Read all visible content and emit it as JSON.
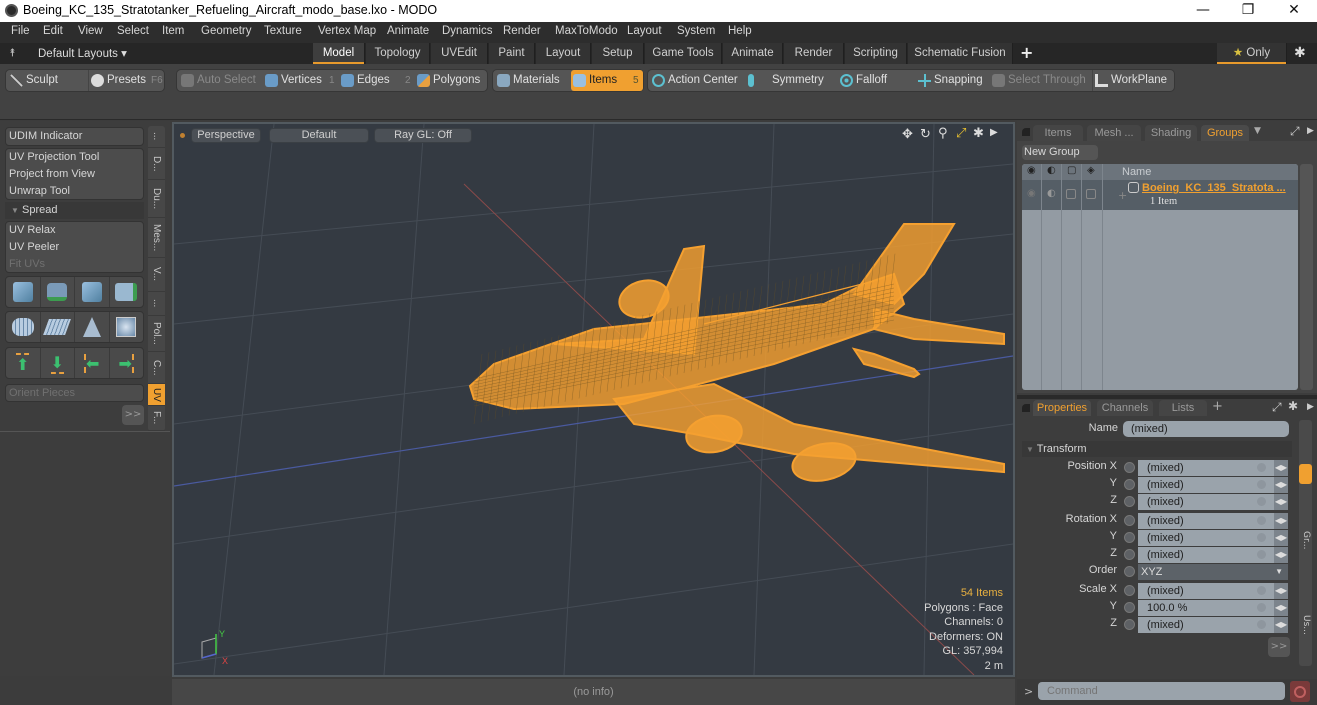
{
  "window": {
    "title": "Boeing_KC_135_Stratotanker_Refueling_Aircraft_modo_base.lxo - MODO",
    "minimize": "—",
    "restore": "❐",
    "close": "✕"
  },
  "menu": [
    "File",
    "Edit",
    "View",
    "Select",
    "Item",
    "Geometry",
    "Texture",
    "Vertex Map",
    "Animate",
    "Dynamics",
    "Render",
    "MaxToModo",
    "Layout",
    "System",
    "Help"
  ],
  "layoutbar": {
    "layouts_label": "Default Layouts ▾",
    "tabs": [
      "Model",
      "Topology",
      "UVEdit",
      "Paint",
      "Layout",
      "Setup",
      "Game Tools",
      "Animate",
      "Render",
      "Scripting",
      "Schematic Fusion"
    ],
    "active_tab": "Model",
    "add": "+",
    "only_label": "Only",
    "star": "★",
    "gear": "✱"
  },
  "toolbar": {
    "sculpt": "Sculpt",
    "presets": "Presets",
    "presets_key": "F6",
    "auto_select": "Auto Select",
    "vertices": "Vertices",
    "vertices_key": "1",
    "edges": "Edges",
    "edges_key": "2",
    "polygons": "Polygons",
    "materials": "Materials",
    "items": "Items",
    "items_key": "5",
    "action_center": "Action Center",
    "symmetry": "Symmetry",
    "falloff": "Falloff",
    "snapping": "Snapping",
    "select_through": "Select Through",
    "workplane": "WorkPlane"
  },
  "leftpanel": {
    "udim": "UDIM Indicator",
    "uv_projection": "UV Projection Tool",
    "project_from_view": "Project from View",
    "unwrap": "Unwrap Tool",
    "spread": "Spread",
    "uv_relax": "UV Relax",
    "uv_peeler": "UV Peeler",
    "fit_uvs": "Fit UVs",
    "orient_pieces": "Orient Pieces",
    "more": ">>",
    "vtabs": [
      "...",
      "D...",
      "Du...",
      "Mes...",
      "V...",
      "...",
      "Pol...",
      "C...",
      "UV",
      "F..."
    ],
    "active_vtab": "UV"
  },
  "viewport": {
    "view": "Perspective",
    "shading": "Default",
    "raygl": "Ray GL: Off",
    "stats": {
      "items": "54 Items",
      "polygons": "Polygons : Face",
      "channels": "Channels: 0",
      "deformers": "Deformers: ON",
      "gl": "GL: 357,994",
      "scale": "2 m"
    },
    "status": "(no info)",
    "wire_color": "#f5a030"
  },
  "groups_panel": {
    "tabs": [
      "Items",
      "Mesh ...",
      "Shading",
      "Groups"
    ],
    "active_tab": "Groups",
    "new_group": "New Group",
    "col_name": "Name",
    "item_name": "Boeing_KC_135_Stratota ...",
    "item_sub": "1 Item"
  },
  "properties_panel": {
    "tabs": [
      "Properties",
      "Channels",
      "Lists"
    ],
    "active_tab": "Properties",
    "add": "+",
    "name_label": "Name",
    "name_value": "(mixed)",
    "section": "Transform",
    "rows": [
      {
        "label": "Position X",
        "value": "(mixed)"
      },
      {
        "label": "Y",
        "value": "(mixed)"
      },
      {
        "label": "Z",
        "value": "(mixed)"
      },
      {
        "label": "Rotation X",
        "value": "(mixed)"
      },
      {
        "label": "Y",
        "value": "(mixed)"
      },
      {
        "label": "Z",
        "value": "(mixed)"
      }
    ],
    "order_label": "Order",
    "order_value": "XYZ",
    "scale_rows": [
      {
        "label": "Scale X",
        "value": "(mixed)"
      },
      {
        "label": "Y",
        "value": "100.0 %"
      },
      {
        "label": "Z",
        "value": "(mixed)"
      }
    ],
    "more": ">>",
    "side_tabs": [
      "...",
      "Gr...",
      "...",
      "...",
      "Us..."
    ]
  },
  "command": {
    "prompt": ">",
    "placeholder": "Command"
  }
}
